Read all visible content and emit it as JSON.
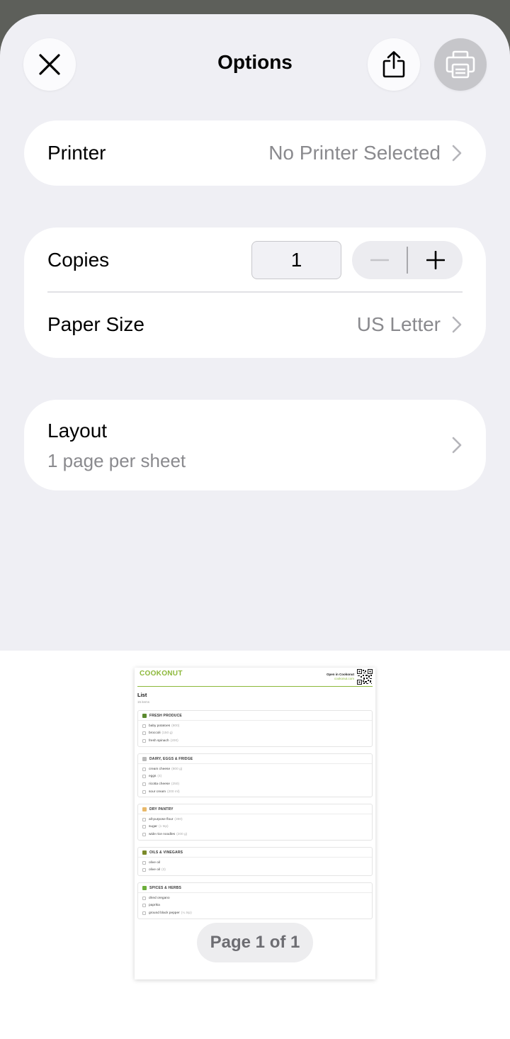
{
  "header": {
    "title": "Options",
    "close_icon": "close-icon",
    "share_icon": "share-icon",
    "print_icon": "printer-icon"
  },
  "printer": {
    "label": "Printer",
    "value": "No Printer Selected"
  },
  "copies": {
    "label": "Copies",
    "value": "1"
  },
  "paper_size": {
    "label": "Paper Size",
    "value": "US Letter"
  },
  "layout": {
    "label": "Layout",
    "value": "1 page per sheet"
  },
  "preview": {
    "logo": "COOKONUT",
    "open_in": "Open in Cookonut",
    "open_in_sub": "cookonut.com",
    "list_title": "List",
    "list_count": "15 items",
    "sections": [
      {
        "name": "FRESH PRODUCE",
        "color": "#5b8a2f",
        "items": [
          {
            "name": "baby potatoes",
            "qty": "(800)"
          },
          {
            "name": "broccoli",
            "qty": "(150 g)"
          },
          {
            "name": "fresh spinach",
            "qty": "(200)"
          }
        ]
      },
      {
        "name": "DAIRY, EGGS & FRIDGE",
        "color": "#b9b9b9",
        "items": [
          {
            "name": "cream cheese",
            "qty": "(800 g)"
          },
          {
            "name": "eggs",
            "qty": "(4)"
          },
          {
            "name": "ricotta cheese",
            "qty": "(250)"
          },
          {
            "name": "sour cream",
            "qty": "(200 ml)"
          }
        ]
      },
      {
        "name": "DRY PANTRY",
        "color": "#e8b86a",
        "items": [
          {
            "name": "all-purpose flour",
            "qty": "(390)"
          },
          {
            "name": "sugar",
            "qty": "(1 tsp)"
          },
          {
            "name": "wide rice noodles",
            "qty": "(200 g)"
          }
        ]
      },
      {
        "name": "OILS & VINEGARS",
        "color": "#7b8a2a",
        "items": [
          {
            "name": "olive oil",
            "qty": ""
          },
          {
            "name": "olive oil",
            "qty": "(3)"
          }
        ]
      },
      {
        "name": "SPICES & HERBS",
        "color": "#6cae3a",
        "items": [
          {
            "name": "dried oregano",
            "qty": ""
          },
          {
            "name": "paprika",
            "qty": ""
          },
          {
            "name": "ground black pepper",
            "qty": "(¼ tsp)"
          }
        ]
      }
    ],
    "page_indicator": "Page 1 of 1"
  }
}
